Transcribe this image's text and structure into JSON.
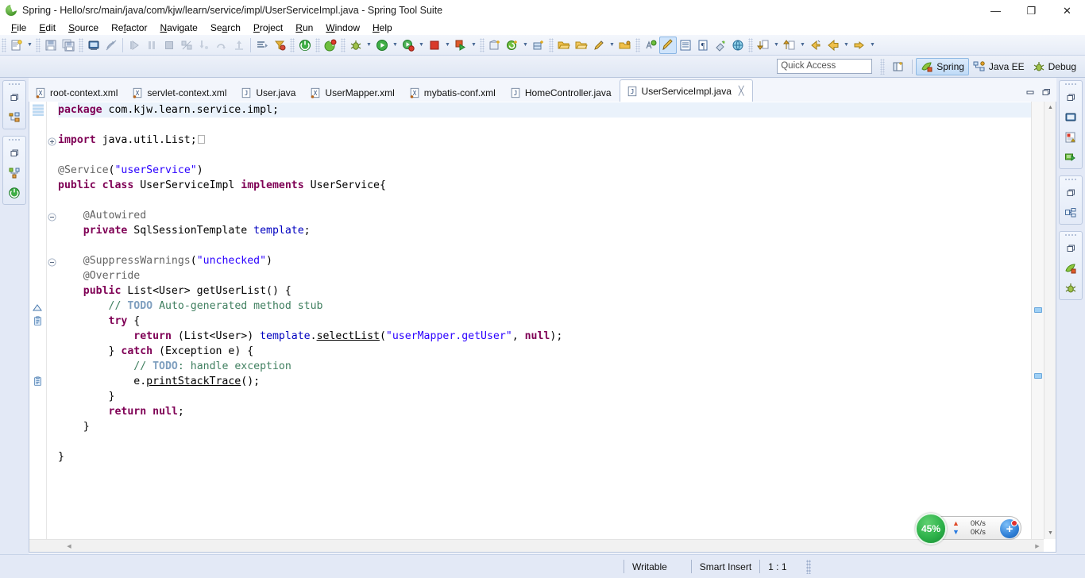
{
  "window": {
    "title": "Spring - Hello/src/main/java/com/kjw/learn/service/impl/UserServiceImpl.java - Spring Tool Suite",
    "app_icon": "spring-leaf-icon",
    "minimize": "—",
    "maximize": "❐",
    "close": "✕"
  },
  "menubar": {
    "items": [
      {
        "label": "File",
        "mnemonic": "F"
      },
      {
        "label": "Edit",
        "mnemonic": "E"
      },
      {
        "label": "Source",
        "mnemonic": "S"
      },
      {
        "label": "Refactor",
        "mnemonic": "R"
      },
      {
        "label": "Navigate",
        "mnemonic": "N"
      },
      {
        "label": "Search",
        "mnemonic": "a"
      },
      {
        "label": "Project",
        "mnemonic": "P"
      },
      {
        "label": "Run",
        "mnemonic": "R"
      },
      {
        "label": "Window",
        "mnemonic": "W"
      },
      {
        "label": "Help",
        "mnemonic": "H"
      }
    ]
  },
  "toolbar": {
    "groups": [
      {
        "icons": [
          "new-wizard-icon"
        ],
        "arrows_after": [
          0
        ]
      },
      {
        "icons": [
          "save-icon",
          "save-all-icon"
        ],
        "arrows_after": []
      },
      {
        "icons": [
          "print-icon"
        ],
        "arrows_after": []
      },
      {
        "icons": [
          "toggle-mark-occurrences-icon"
        ],
        "arrows_after": []
      },
      {
        "icons": [
          "resume-icon",
          "suspend-icon",
          "terminate-icon",
          "disconnect-icon",
          "step-into-icon",
          "step-over-icon",
          "step-return-icon"
        ],
        "arrows_after": []
      },
      {
        "icons": [
          "open-type-icon",
          "open-task-icon"
        ],
        "arrows_after": []
      },
      {
        "icons": [
          "boot-dashboard-icon"
        ],
        "arrows_after": []
      },
      {
        "icons": [
          "spring-run-icon"
        ],
        "arrows_after": []
      },
      {
        "icons": [
          "debug-icon"
        ],
        "arrows_after": [
          0
        ]
      },
      {
        "icons": [
          "run-icon"
        ],
        "arrows_after": [
          0
        ]
      },
      {
        "icons": [
          "run-server-icon"
        ],
        "arrows_after": [
          0
        ]
      },
      {
        "icons": [
          "stop-icon"
        ],
        "arrows_after": [
          0
        ]
      },
      {
        "icons": [
          "run-external-icon"
        ],
        "arrows_after": [
          0
        ]
      },
      {
        "icons": [
          "new-package-icon",
          "new-java-project-icon"
        ],
        "arrows_after": [
          1
        ]
      },
      {
        "icons": [
          "new-class-icon"
        ],
        "arrows_after": []
      },
      {
        "icons": [
          "open-folder-icon",
          "open-folder2-icon",
          "search-pencil-icon"
        ],
        "arrows_after": [
          2
        ]
      },
      {
        "icons": [
          "open-resource-icon"
        ],
        "arrows_after": []
      },
      {
        "icons": [
          "spell-check-icon",
          "link-editor-icon",
          "show-whitespace-icon",
          "block-selection-icon",
          "toggle-ruler-icon",
          "web-browser-icon"
        ],
        "arrows_after": []
      },
      {
        "icons": [
          "previous-annotation-icon"
        ],
        "arrows_after": [
          0
        ]
      },
      {
        "icons": [
          "next-annotation-icon"
        ],
        "arrows_after": [
          0
        ]
      },
      {
        "icons": [
          "back-history-icon",
          "backward-icon"
        ],
        "arrows_after": [
          1
        ]
      },
      {
        "icons": [
          "forward-icon"
        ],
        "arrows_after": [
          0
        ]
      }
    ]
  },
  "perspective_bar": {
    "quick_access_placeholder": "Quick Access",
    "open_perspective_icon": "open-perspective-icon",
    "perspectives": [
      {
        "label": "Spring",
        "icon": "spring-perspective-icon",
        "selected": true
      },
      {
        "label": "Java EE",
        "icon": "javaee-perspective-icon",
        "selected": false
      },
      {
        "label": "Debug",
        "icon": "debug-perspective-icon",
        "selected": false
      }
    ]
  },
  "left_trim": {
    "stacks": [
      {
        "restore": "restore-icon",
        "views": [
          {
            "icon": "package-explorer-icon",
            "name": "package-explorer"
          }
        ]
      },
      {
        "restore": "restore-icon",
        "views": [
          {
            "icon": "spring-explorer-icon",
            "name": "spring-explorer"
          },
          {
            "icon": "boot-dashboard-trim-icon",
            "name": "boot-dashboard"
          }
        ]
      }
    ]
  },
  "right_trim": {
    "stacks": [
      {
        "restore": "restore-icon",
        "views": [
          {
            "icon": "console-icon",
            "name": "console"
          },
          {
            "icon": "problems-icon",
            "name": "problems"
          },
          {
            "icon": "servers-icon",
            "name": "servers"
          }
        ]
      },
      {
        "restore": "restore-icon",
        "views": [
          {
            "icon": "outline-icon",
            "name": "outline"
          }
        ]
      },
      {
        "restore": "restore-icon",
        "views": [
          {
            "icon": "spring-view-icon",
            "name": "spring-view"
          },
          {
            "icon": "debug-view-icon",
            "name": "debug-view"
          }
        ]
      }
    ]
  },
  "editor": {
    "tabs": [
      {
        "label": "root-context.xml",
        "icon": "xml-file-icon",
        "selected": false,
        "closable": false
      },
      {
        "label": "servlet-context.xml",
        "icon": "xml-file-icon",
        "selected": false,
        "closable": false
      },
      {
        "label": "User.java",
        "icon": "java-file-icon",
        "selected": false,
        "closable": false
      },
      {
        "label": "UserMapper.xml",
        "icon": "xml-file-icon",
        "selected": false,
        "closable": false
      },
      {
        "label": "mybatis-conf.xml",
        "icon": "xml-file-icon",
        "selected": false,
        "closable": false
      },
      {
        "label": "HomeController.java",
        "icon": "java-file-icon",
        "selected": false,
        "closable": false
      },
      {
        "label": "UserServiceImpl.java",
        "icon": "java-file-icon",
        "selected": true,
        "closable": true,
        "close_glyph": "╳"
      }
    ],
    "minimize_tooltip": "Minimize",
    "maximize_tooltip": "Maximize",
    "gutter_markers": [
      {
        "row": 0,
        "type": "changed-line-bar"
      },
      {
        "row": 2,
        "type": "fold-expand-plus"
      },
      {
        "row": 7,
        "type": "fold-collapse-minus"
      },
      {
        "row": 10,
        "type": "fold-collapse-minus"
      },
      {
        "row": 13,
        "type": "overridden-method-arrow"
      },
      {
        "row": 14,
        "type": "todo-task-icon"
      },
      {
        "row": 18,
        "type": "todo-task-icon"
      }
    ],
    "overview_marks": [
      {
        "top_pct": 47,
        "name": "todo-marker"
      },
      {
        "top_pct": 62,
        "name": "todo-marker"
      }
    ],
    "code_lines": [
      {
        "current": true,
        "tokens": [
          {
            "t": "package",
            "c": "kw"
          },
          {
            "t": " com.kjw.learn.service.impl;",
            "c": ""
          }
        ]
      },
      {
        "current": false,
        "tokens": []
      },
      {
        "current": false,
        "tokens": [
          {
            "t": "import",
            "c": "kw"
          },
          {
            "t": " java.util.List;",
            "c": ""
          },
          {
            "t": "⎕",
            "c": "fold-box"
          }
        ]
      },
      {
        "current": false,
        "tokens": []
      },
      {
        "current": false,
        "tokens": [
          {
            "t": "@Service",
            "c": "anno"
          },
          {
            "t": "(",
            "c": ""
          },
          {
            "t": "\"userService\"",
            "c": "str"
          },
          {
            "t": ")",
            "c": ""
          }
        ]
      },
      {
        "current": false,
        "tokens": [
          {
            "t": "public",
            "c": "kw"
          },
          {
            "t": " ",
            "c": ""
          },
          {
            "t": "class",
            "c": "kw"
          },
          {
            "t": " UserServiceImpl ",
            "c": ""
          },
          {
            "t": "implements",
            "c": "kw"
          },
          {
            "t": " UserService{",
            "c": ""
          }
        ]
      },
      {
        "current": false,
        "tokens": []
      },
      {
        "current": false,
        "tokens": [
          {
            "t": "    @Autowired",
            "c": "anno"
          }
        ]
      },
      {
        "current": false,
        "tokens": [
          {
            "t": "    ",
            "c": ""
          },
          {
            "t": "private",
            "c": "kw"
          },
          {
            "t": " SqlSessionTemplate ",
            "c": ""
          },
          {
            "t": "template",
            "c": "fld"
          },
          {
            "t": ";",
            "c": ""
          }
        ]
      },
      {
        "current": false,
        "tokens": []
      },
      {
        "current": false,
        "tokens": [
          {
            "t": "    @SuppressWarnings",
            "c": "anno"
          },
          {
            "t": "(",
            "c": ""
          },
          {
            "t": "\"unchecked\"",
            "c": "str"
          },
          {
            "t": ")",
            "c": ""
          }
        ]
      },
      {
        "current": false,
        "tokens": [
          {
            "t": "    @Override",
            "c": "anno"
          }
        ]
      },
      {
        "current": false,
        "tokens": [
          {
            "t": "    ",
            "c": ""
          },
          {
            "t": "public",
            "c": "kw"
          },
          {
            "t": " List<User> getUserList() {",
            "c": ""
          }
        ]
      },
      {
        "current": false,
        "tokens": [
          {
            "t": "        ",
            "c": ""
          },
          {
            "t": "// ",
            "c": "cmt"
          },
          {
            "t": "TODO",
            "c": "todo"
          },
          {
            "t": " Auto-generated method stub",
            "c": "cmt"
          }
        ]
      },
      {
        "current": false,
        "tokens": [
          {
            "t": "        ",
            "c": ""
          },
          {
            "t": "try",
            "c": "kw"
          },
          {
            "t": " {",
            "c": ""
          }
        ]
      },
      {
        "current": false,
        "tokens": [
          {
            "t": "            ",
            "c": ""
          },
          {
            "t": "return",
            "c": "kw"
          },
          {
            "t": " (List<User>) ",
            "c": ""
          },
          {
            "t": "template",
            "c": "fld"
          },
          {
            "t": ".",
            "c": ""
          },
          {
            "t": "selectList",
            "c": "mth"
          },
          {
            "t": "(",
            "c": ""
          },
          {
            "t": "\"userMapper.getUser\"",
            "c": "str"
          },
          {
            "t": ", ",
            "c": ""
          },
          {
            "t": "null",
            "c": "kw"
          },
          {
            "t": ");",
            "c": ""
          }
        ]
      },
      {
        "current": false,
        "tokens": [
          {
            "t": "        } ",
            "c": ""
          },
          {
            "t": "catch",
            "c": "kw"
          },
          {
            "t": " (Exception e) {",
            "c": ""
          }
        ]
      },
      {
        "current": false,
        "tokens": [
          {
            "t": "            ",
            "c": ""
          },
          {
            "t": "// ",
            "c": "cmt"
          },
          {
            "t": "TODO",
            "c": "todo"
          },
          {
            "t": ": handle exception",
            "c": "cmt"
          }
        ]
      },
      {
        "current": false,
        "tokens": [
          {
            "t": "            e.",
            "c": ""
          },
          {
            "t": "printStackTrace",
            "c": "mth"
          },
          {
            "t": "();",
            "c": ""
          }
        ]
      },
      {
        "current": false,
        "tokens": [
          {
            "t": "        }",
            "c": ""
          }
        ]
      },
      {
        "current": false,
        "tokens": [
          {
            "t": "        ",
            "c": ""
          },
          {
            "t": "return",
            "c": "kw"
          },
          {
            "t": " ",
            "c": ""
          },
          {
            "t": "null",
            "c": "kw"
          },
          {
            "t": ";",
            "c": ""
          }
        ]
      },
      {
        "current": false,
        "tokens": [
          {
            "t": "    }",
            "c": ""
          }
        ]
      },
      {
        "current": false,
        "tokens": []
      },
      {
        "current": false,
        "tokens": [
          {
            "t": "}",
            "c": ""
          }
        ]
      }
    ]
  },
  "speed_widget": {
    "percent_label": "45%",
    "upload_icon": "arrow-up-icon",
    "upload_rate": "0K/s",
    "download_icon": "arrow-down-icon",
    "download_rate": "0K/s",
    "plus_label": "+",
    "badge": "notification-dot"
  },
  "statusbar": {
    "writable": "Writable",
    "insert_mode": "Smart Insert",
    "position": "1 : 1"
  },
  "colors": {
    "accent": "#2f7fd6",
    "keyword": "#7f0055",
    "string": "#2a00ff",
    "field": "#0000c0",
    "annotation": "#646464",
    "comment": "#3f7f5f",
    "todo": "#7f9fbf",
    "speed_green": "#2eb24a",
    "chrome": "#e3e9f6"
  }
}
